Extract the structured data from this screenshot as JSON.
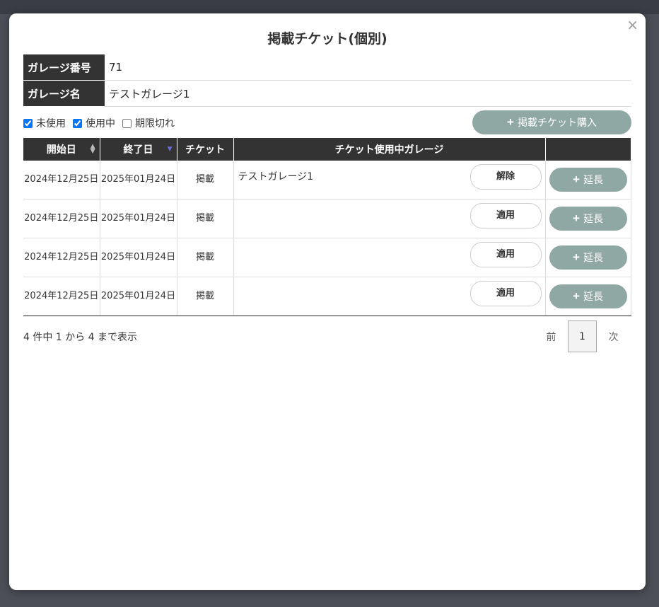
{
  "modal": {
    "title": "掲載チケット(個別)",
    "close": "×"
  },
  "info": {
    "garage_number_label": "ガレージ番号",
    "garage_number": "71",
    "garage_name_label": "ガレージ名",
    "garage_name": "テストガレージ1"
  },
  "filters": [
    {
      "label": "未使用",
      "checked": true
    },
    {
      "label": "使用中",
      "checked": true
    },
    {
      "label": "期限切れ",
      "checked": false
    }
  ],
  "purchase_button": "掲載チケット購入",
  "table": {
    "headers": [
      "開始日",
      "終了日",
      "チケット",
      "チケット使用中ガレージ",
      ""
    ],
    "rows": [
      {
        "start": "2024年12月25日",
        "end": "2025年01月24日",
        "ticket": "掲載",
        "garage": "テストガレージ1",
        "action": "解除",
        "extend": "延長"
      },
      {
        "start": "2024年12月25日",
        "end": "2025年01月24日",
        "ticket": "掲載",
        "garage": "",
        "action": "適用",
        "extend": "延長"
      },
      {
        "start": "2024年12月25日",
        "end": "2025年01月24日",
        "ticket": "掲載",
        "garage": "",
        "action": "適用",
        "extend": "延長"
      },
      {
        "start": "2024年12月25日",
        "end": "2025年01月24日",
        "ticket": "掲載",
        "garage": "",
        "action": "適用",
        "extend": "延長"
      }
    ]
  },
  "pagination": {
    "info": "4 件中 1 から 4 まで表示",
    "prev": "前",
    "page": "1",
    "next": "次"
  },
  "colors": {
    "header_bg": "#333333",
    "accent_button": "#8fa8a3"
  }
}
